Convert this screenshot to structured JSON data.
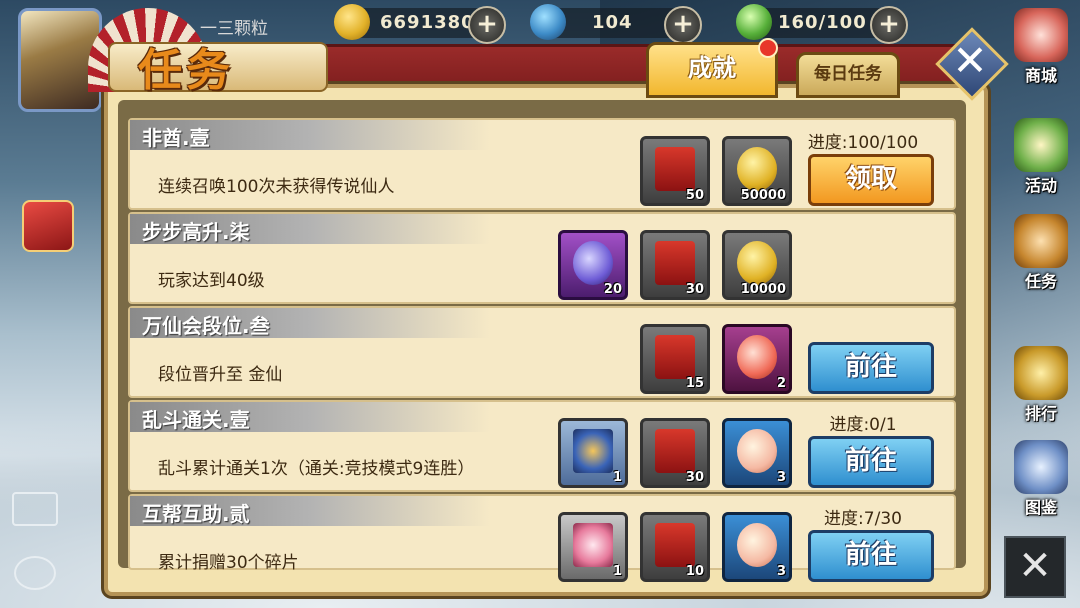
{
  "resources": [
    {
      "icon": "coin-icon",
      "value": "6691380"
    },
    {
      "icon": "gem-icon",
      "value": "104"
    },
    {
      "icon": "energy-icon",
      "value": "160/100"
    }
  ],
  "player": {
    "name": "一三颗粒"
  },
  "side_menu": [
    {
      "icon": "shop-icon",
      "label": "商城"
    },
    {
      "icon": "event-icon",
      "label": "活动"
    },
    {
      "icon": "mission-icon",
      "label": "任务"
    },
    {
      "icon": "ranking-icon",
      "label": "排行"
    },
    {
      "icon": "codex-icon",
      "label": "图鉴"
    }
  ],
  "panel": {
    "title": "任务",
    "tabs": [
      {
        "label": "成就",
        "active": true,
        "badge": true
      },
      {
        "label": "每日任务",
        "active": false
      }
    ]
  },
  "tasks": [
    {
      "name": "非酋.壹",
      "desc": "连续召唤100次未获得传说仙人",
      "progress": "进度:100/100",
      "rewards": [
        {
          "type": "scroll",
          "qty": "50"
        },
        {
          "type": "coin",
          "qty": "50000"
        }
      ],
      "button": "领取",
      "button_type": "claim"
    },
    {
      "name": "步步高升.柒",
      "desc": "玩家达到40级",
      "progress": "",
      "rewards": [
        {
          "type": "bottle",
          "qty": "20"
        },
        {
          "type": "scroll",
          "qty": "30"
        },
        {
          "type": "coin",
          "qty": "10000"
        }
      ],
      "button": "",
      "button_type": "none"
    },
    {
      "name": "万仙会段位.叁",
      "desc": "段位晋升至  金仙",
      "progress": "",
      "rewards": [
        {
          "type": "scroll",
          "qty": "15"
        },
        {
          "type": "peach-purple",
          "qty": "2"
        }
      ],
      "button": "前往",
      "button_type": "go"
    },
    {
      "name": "乱斗通关.壹",
      "desc": "乱斗累计通关1次（通关:竞技模式9连胜）",
      "progress": "进度:0/1",
      "rewards": [
        {
          "type": "dragon",
          "qty": "1"
        },
        {
          "type": "scroll",
          "qty": "30"
        },
        {
          "type": "peach-blue",
          "qty": "3"
        }
      ],
      "button": "前往",
      "button_type": "go"
    },
    {
      "name": "互帮互助.贰",
      "desc": "累计捐赠30个碎片",
      "progress": "进度:7/30",
      "rewards": [
        {
          "type": "girl",
          "qty": "1"
        },
        {
          "type": "scroll",
          "qty": "10"
        },
        {
          "type": "peach-blue",
          "qty": "3"
        }
      ],
      "button": "前往",
      "button_type": "go"
    }
  ],
  "colors": {
    "panel_bg": "#f3e3b0",
    "header_red": "#9a2b2a",
    "claim_orange": "#f29820",
    "go_blue": "#2f8fcf"
  }
}
